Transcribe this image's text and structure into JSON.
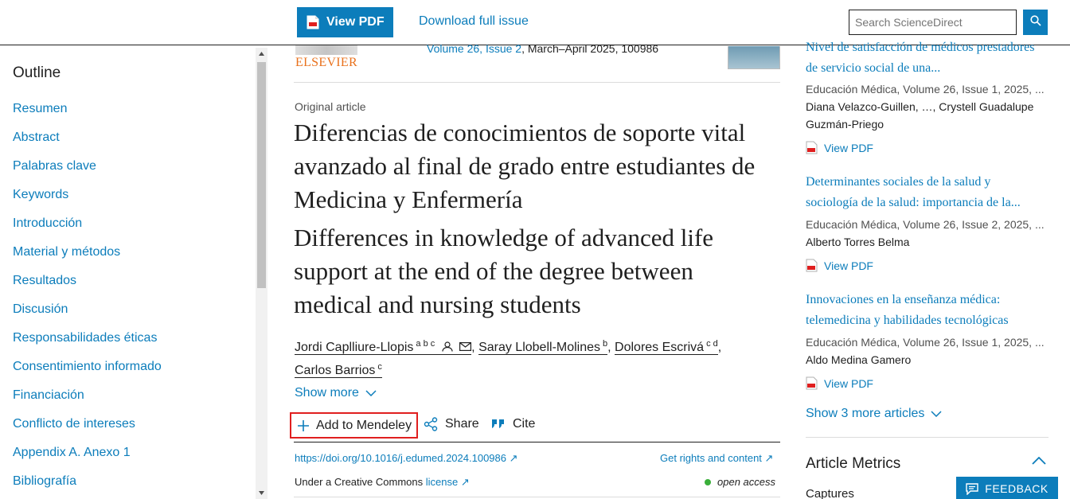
{
  "topbar": {
    "view_pdf": "View PDF",
    "download_issue": "Download full issue",
    "search_placeholder": "Search ScienceDirect"
  },
  "outline": {
    "title": "Outline",
    "items": [
      "Resumen",
      "Abstract",
      "Palabras clave",
      "Keywords",
      "Introducción",
      "Material y métodos",
      "Resultados",
      "Discusión",
      "Responsabilidades éticas",
      "Consentimiento informado",
      "Financiación",
      "Conflicto de intereses",
      "Appendix A. Anexo 1",
      "Bibliografía"
    ]
  },
  "article": {
    "publisher": "ELSEVIER",
    "volume_issue": "Volume 26, Issue 2",
    "date_id": ", March–April 2025, 100986",
    "type": "Original article",
    "title_es": "Diferencias de conocimientos de soporte vital avanzado al final de grado entre estudiantes de Medicina y Enfermería",
    "title_en": "Differences in knowledge of advanced life support at the end of the degree between medical and nursing students",
    "authors": [
      {
        "name": "Jordi Caplliure-Llopis",
        "sup": "a b c"
      },
      {
        "name": "Saray Llobell-Molines",
        "sup": "b"
      },
      {
        "name": "Dolores Escrivá",
        "sup": "c d"
      },
      {
        "name": "Carlos Barrios",
        "sup": "c"
      }
    ],
    "show_more": "Show more",
    "add_mendeley": "Add to Mendeley",
    "share": "Share",
    "cite": "Cite",
    "doi": "https://doi.org/10.1016/j.edumed.2024.100986",
    "rights": "Get rights and content",
    "cc_prefix": "Under a Creative Commons ",
    "cc_link": "license",
    "open_access": "open access"
  },
  "related": [
    {
      "title": "Nivel de satisfacción de médicos prestadores de servicio social de una...",
      "meta": "Educación Médica, Volume 26, Issue 1, 2025, ...",
      "authors": "Diana Velazco-Guillen, …, Crystell Guadalupe Guzmán-Priego",
      "pdf": "View PDF"
    },
    {
      "title": "Determinantes sociales de la salud y sociología de la salud: importancia de la...",
      "meta": "Educación Médica, Volume 26, Issue 2, 2025, ...",
      "authors": "Alberto Torres Belma",
      "pdf": "View PDF"
    },
    {
      "title": "Innovaciones en la enseñanza médica: telemedicina y habilidades tecnológicas",
      "meta": "Educación Médica, Volume 26, Issue 1, 2025, ...",
      "authors": "Aldo Medina Gamero",
      "pdf": "View PDF"
    }
  ],
  "show_more_articles": "Show 3 more articles",
  "metrics_title": "Article Metrics",
  "captures": "Captures",
  "feedback": "FEEDBACK",
  "colors": {
    "accent": "#0c7dbb",
    "elsevier_orange": "#e9711c",
    "highlight_red": "#e01f1f",
    "open_access_green": "#3aaf3a"
  }
}
